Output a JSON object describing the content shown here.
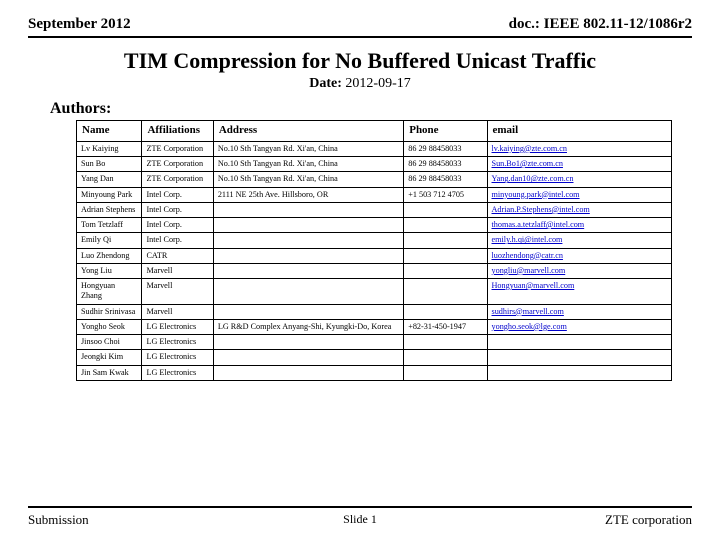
{
  "header": {
    "left": "September 2012",
    "right": "doc.: IEEE 802.11-12/1086r2"
  },
  "title": "TIM Compression for No Buffered Unicast Traffic",
  "date_label": "Date:",
  "date_value": "2012-09-17",
  "authors_label": "Authors:",
  "columns": {
    "name": "Name",
    "affiliation": "Affiliations",
    "address": "Address",
    "phone": "Phone",
    "email": "email"
  },
  "authors": [
    {
      "name": "Lv Kaiying",
      "affiliation": "ZTE Corporation",
      "address": "No.10 Sth Tangyan Rd. Xi'an, China",
      "phone": "86 29 88458033",
      "email": "lv.kaiying@zte.com.cn"
    },
    {
      "name": "Sun Bo",
      "affiliation": "ZTE Corporation",
      "address": "No.10 Sth Tangyan Rd. Xi'an, China",
      "phone": "86 29 88458033",
      "email": "Sun.Bo1@zte.com.cn"
    },
    {
      "name": "Yang Dan",
      "affiliation": "ZTE Corporation",
      "address": "No.10 Sth Tangyan Rd. Xi'an, China",
      "phone": "86 29 88458033",
      "email": "Yang.dan10@zte.com.cn"
    },
    {
      "name": "Minyoung Park",
      "affiliation": "Intel Corp.",
      "address": "2111 NE 25th Ave. Hillsboro, OR",
      "phone": "+1 503 712 4705",
      "email": "minyoung.park@intel.com"
    },
    {
      "name": "Adrian Stephens",
      "affiliation": "Intel Corp.",
      "address": "",
      "phone": "",
      "email": "Adrian.P.Stephens@intel.com"
    },
    {
      "name": "Tom Tetzlaff",
      "affiliation": "Intel Corp.",
      "address": "",
      "phone": "",
      "email": "thomas.a.tetzlaff@intel.com"
    },
    {
      "name": "Emily Qi",
      "affiliation": "Intel Corp.",
      "address": "",
      "phone": "",
      "email": "emily.h.qi@intel.com"
    },
    {
      "name": "Luo Zhendong",
      "affiliation": "CATR",
      "address": "",
      "phone": "",
      "email": "luozhendong@catr.cn"
    },
    {
      "name": "Yong Liu",
      "affiliation": "Marvell",
      "address": "",
      "phone": "",
      "email": "yongliu@marvell.com"
    },
    {
      "name": "Hongyuan Zhang",
      "affiliation": "Marvell",
      "address": "",
      "phone": "",
      "email": "Hongyuan@marvell.com"
    },
    {
      "name": "Sudhir Srinivasa",
      "affiliation": "Marvell",
      "address": "",
      "phone": "",
      "email": "sudhirs@marvell.com"
    },
    {
      "name": "Yongho Seok",
      "affiliation": "LG Electronics",
      "address": "LG R&D Complex Anyang-Shi, Kyungki-Do, Korea",
      "phone": "+82-31-450-1947",
      "email": "yongho.seok@lge.com"
    },
    {
      "name": "Jinsoo Choi",
      "affiliation": "LG Electronics",
      "address": "",
      "phone": "",
      "email": ""
    },
    {
      "name": "Jeongki Kim",
      "affiliation": "LG Electronics",
      "address": "",
      "phone": "",
      "email": ""
    },
    {
      "name": "Jin Sam Kwak",
      "affiliation": "LG Electronics",
      "address": "",
      "phone": "",
      "email": ""
    }
  ],
  "footer": {
    "left": "Submission",
    "center": "Slide 1",
    "right": "ZTE corporation"
  }
}
